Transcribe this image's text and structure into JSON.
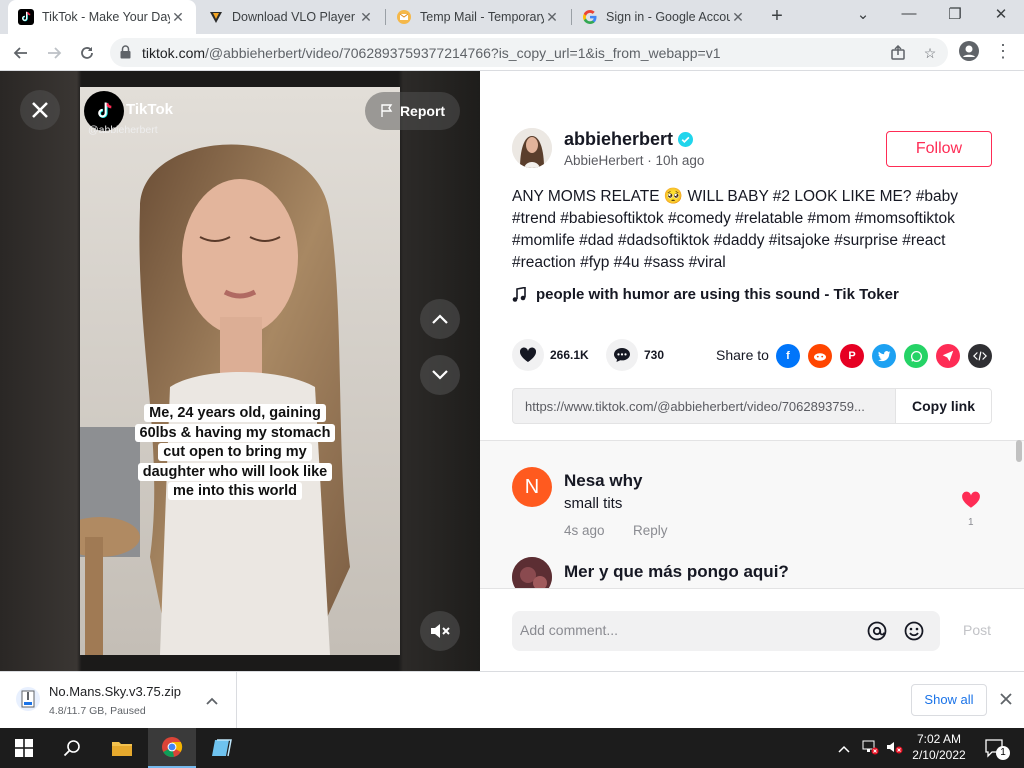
{
  "browser": {
    "tabs": [
      {
        "title": "TikTok - Make Your Day",
        "icon": "tiktok-icon",
        "active": true
      },
      {
        "title": "Download VLO Player",
        "icon": "vlo-icon",
        "active": false
      },
      {
        "title": "Temp Mail - Temporary",
        "icon": "tempmail-icon",
        "active": false
      },
      {
        "title": "Sign in - Google Accounts",
        "icon": "google-icon",
        "active": false
      }
    ],
    "new_tab_label": "+",
    "url_host": "tiktok.com",
    "url_path": "/@abbieherbert/video/7062893759377214766?is_copy_url=1&is_from_webapp=v1"
  },
  "video": {
    "watermark_text": "TikTok",
    "watermark_handle": "@abbieherbert",
    "report_label": "Report",
    "caption": "Me, 24 years old, gaining 60lbs & having my stomach cut open to bring my daughter who will look like me into this world"
  },
  "post": {
    "username": "abbieherbert",
    "display_name": "AbbieHerbert",
    "time_ago": "10h ago",
    "follow_label": "Follow",
    "description_prefix": "ANY MOMS RELATE",
    "description_emoji": "🥺",
    "description_rest": "WILL BABY #2 LOOK LIKE ME? #baby #trend #babiesoftiktok #comedy #relatable #mom #momsoftiktok #momlife #dad #dadsoftiktok #daddy #itsajoke #surprise #react #reaction #fyp #4u #sass #viral",
    "music": "people with humor are using this sound - Tik Toker",
    "likes": "266.1K",
    "comments_count": "730",
    "share_label": "Share to",
    "share_targets": [
      "facebook-icon",
      "reddit-icon",
      "pinterest-icon",
      "twitter-icon",
      "whatsapp-icon",
      "telegram-icon",
      "embed-icon"
    ],
    "link": "https://www.tiktok.com/@abbieherbert/video/7062893759...",
    "copy_label": "Copy link"
  },
  "comments": [
    {
      "avatar_letter": "N",
      "name": "Nesa why",
      "text": "small tits",
      "time": "4s ago",
      "reply_label": "Reply",
      "likes": "1"
    },
    {
      "name": "Mer y que más pongo aqui?"
    }
  ],
  "comment_input": {
    "placeholder": "Add comment...",
    "post_label": "Post"
  },
  "download": {
    "filename": "No.Mans.Sky.v3.75.zip",
    "status": "4.8/11.7 GB, Paused",
    "show_all_label": "Show all"
  },
  "taskbar": {
    "time": "7:02 AM",
    "date": "2/10/2022",
    "notification_count": "1"
  },
  "colors": {
    "accent": "#fe2c55",
    "verified": "#20d5ec"
  }
}
